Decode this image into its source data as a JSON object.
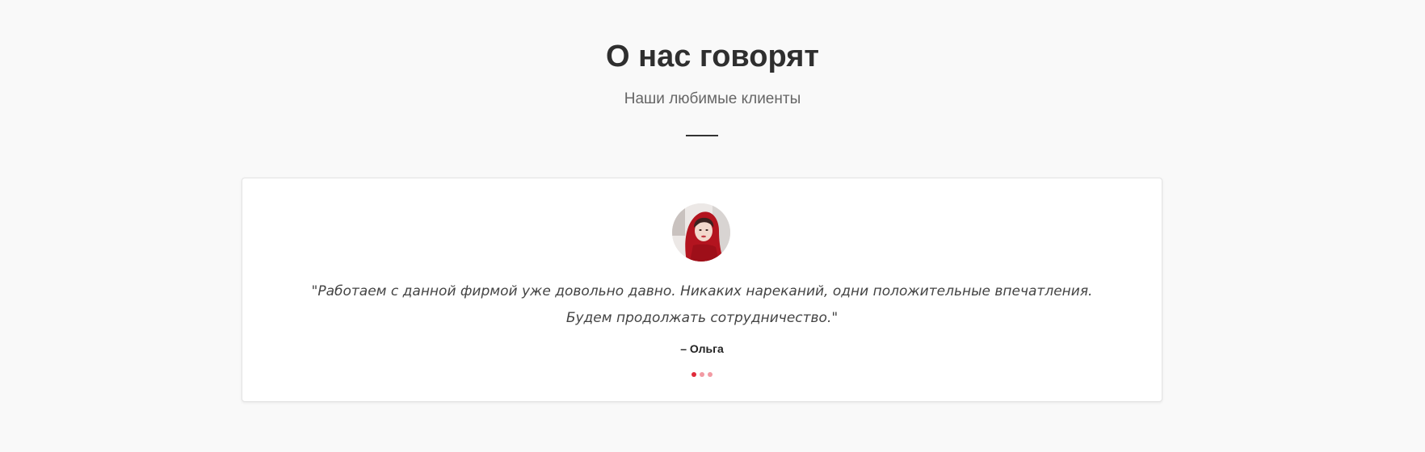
{
  "section": {
    "title": "О нас говорят",
    "subtitle": "Наши любимые клиенты"
  },
  "testimonial": {
    "avatar_icon": "client-photo-woman-red-scarf",
    "quote": "\"Работаем с данной фирмой уже довольно давно. Никаких нареканий, одни положительные впечатления. Будем продолжать сотрудничество.\"",
    "author": "– Ольга"
  },
  "carousel": {
    "active_index": 0,
    "total": 3,
    "active_color": "#e02b3a",
    "inactive_color": "#f29aa3"
  }
}
